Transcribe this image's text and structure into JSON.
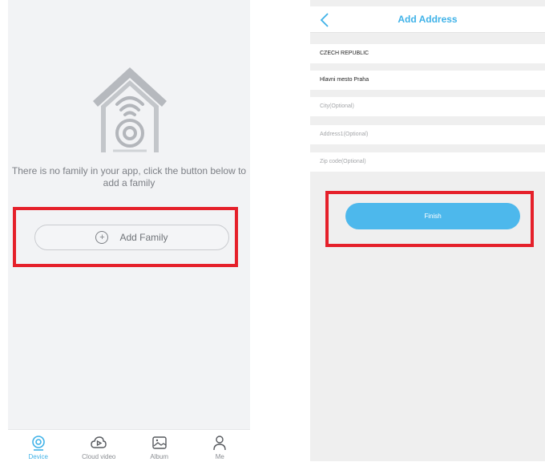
{
  "left_screen": {
    "empty_message": "There is no family in your app, click the button below to add a family",
    "add_family_label": "Add Family",
    "add_family_icon": "plus-circle-icon",
    "tabs": [
      {
        "label": "Device",
        "icon": "device-camera-icon",
        "active": true
      },
      {
        "label": "Cloud video",
        "icon": "cloud-play-icon",
        "active": false
      },
      {
        "label": "Album",
        "icon": "album-image-icon",
        "active": false
      },
      {
        "label": "Me",
        "icon": "person-icon",
        "active": false
      }
    ]
  },
  "right_screen": {
    "title": "Add Address",
    "back_icon": "chevron-left-icon",
    "fields": {
      "country": {
        "value": "CZECH REPUBLIC"
      },
      "region": {
        "value": "Hlavni mesto Praha"
      },
      "city": {
        "placeholder": "City(Optional)"
      },
      "address1": {
        "placeholder": "Address1(Optional)"
      },
      "zip": {
        "placeholder": "Zip code(Optional)"
      }
    },
    "finish_label": "Finish"
  },
  "colors": {
    "accent": "#3fb2e8",
    "highlight": "#e5202a",
    "screen_bg": "#f2f3f5"
  }
}
